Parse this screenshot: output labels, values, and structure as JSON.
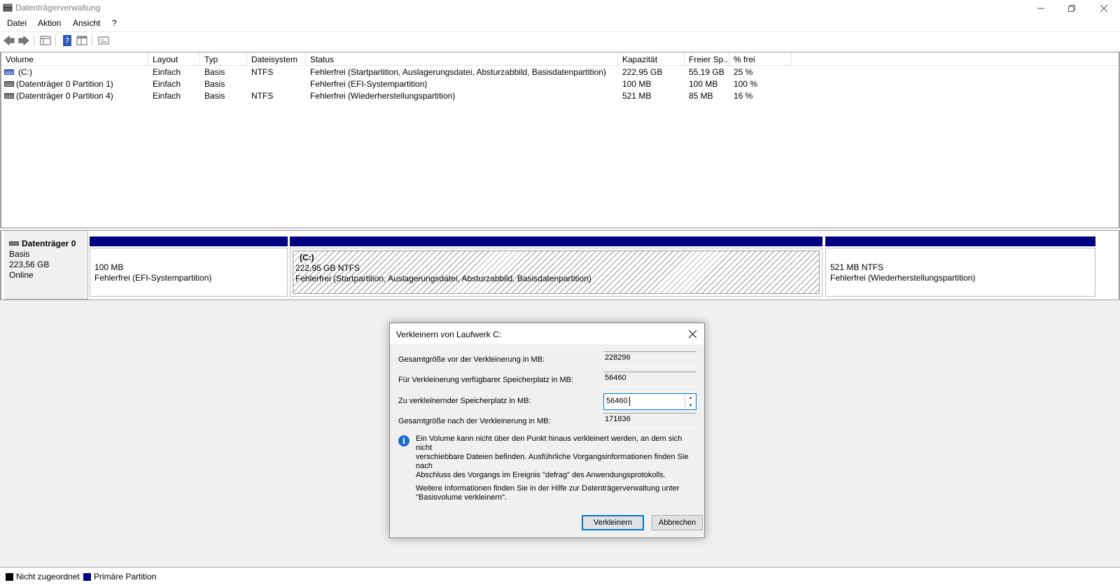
{
  "window": {
    "title": "Datenträgerverwaltung",
    "controls": [
      "minimize",
      "restore",
      "close"
    ]
  },
  "menu": [
    "Datei",
    "Aktion",
    "Ansicht",
    "?"
  ],
  "toolbar": {
    "icons": [
      "back-icon",
      "forward-icon",
      "list-view-icon",
      "help-icon",
      "properties-icon",
      "console-icon"
    ]
  },
  "volume_list": {
    "columns": [
      "Volume",
      "Layout",
      "Typ",
      "Dateisystem",
      "Status",
      "Kapazität",
      "Freier Sp...",
      "% frei"
    ],
    "rows": [
      {
        "volume": "(C:)",
        "layout": "Einfach",
        "typ": "Basis",
        "fs": "NTFS",
        "status": "Fehlerfrei (Startpartition, Auslagerungsdatei, Absturzabbild, Basisdatenpartition)",
        "kapazitaet": "222,95 GB",
        "frei": "55,19 GB",
        "pct": "25 %"
      },
      {
        "volume": "(Datenträger 0 Partition 1)",
        "layout": "Einfach",
        "typ": "Basis",
        "fs": "",
        "status": "Fehlerfrei (EFI-Systempartition)",
        "kapazitaet": "100 MB",
        "frei": "100 MB",
        "pct": "100 %"
      },
      {
        "volume": "(Datenträger 0 Partition 4)",
        "layout": "Einfach",
        "typ": "Basis",
        "fs": "NTFS",
        "status": "Fehlerfrei (Wiederherstellungspartition)",
        "kapazitaet": "521 MB",
        "frei": "85 MB",
        "pct": "16 %"
      }
    ]
  },
  "disk": {
    "name": "Datenträger 0",
    "type": "Basis",
    "size": "223,56 GB",
    "state": "Online",
    "partitions": [
      {
        "name": "",
        "size": "100 MB",
        "status": "Fehlerfrei (EFI-Systempartition)"
      },
      {
        "name": "(C:)",
        "size": "222,95 GB NTFS",
        "status": "Fehlerfrei (Startpartition, Auslagerungsdatei, Absturzabbild, Basisdatenpartition)"
      },
      {
        "name": "",
        "size": "521 MB NTFS",
        "status": "Fehlerfrei (Wiederherstellungspartition)"
      }
    ]
  },
  "legend": [
    {
      "label": "Nicht zugeordnet",
      "color": "#000000"
    },
    {
      "label": "Primäre Partition",
      "color": "#000080"
    }
  ],
  "dialog": {
    "title": "Verkleinern von Laufwerk C:",
    "fields": {
      "total_before_label": "Gesamtgröße vor der Verkleinerung in MB:",
      "total_before_value": "228296",
      "available_label": "Für Verkleinerung verfügbarer Speicherplatz in MB:",
      "available_value": "56460",
      "shrink_label": "Zu verkleinernder Speicherplatz in MB:",
      "shrink_value": "56460",
      "total_after_label": "Gesamtgröße nach der Verkleinerung in MB:",
      "total_after_value": "171836"
    },
    "info_lines": [
      "Ein Volume kann nicht über den Punkt hinaus verkleinert werden, an dem sich nicht",
      "verschiebbare Dateien befinden. Ausführliche Vorgangsinformationen finden Sie nach",
      "Abschluss des Vorgangs im Ereignis \"defrag\" des Anwendungsprotokolls."
    ],
    "more_lines": [
      "Weitere Informationen finden Sie in der Hilfe zur Datenträgerverwaltung unter",
      "\"Basisvolume verkleinern\"."
    ],
    "ok_label": "Verkleinern",
    "cancel_label": "Abbrechen"
  }
}
